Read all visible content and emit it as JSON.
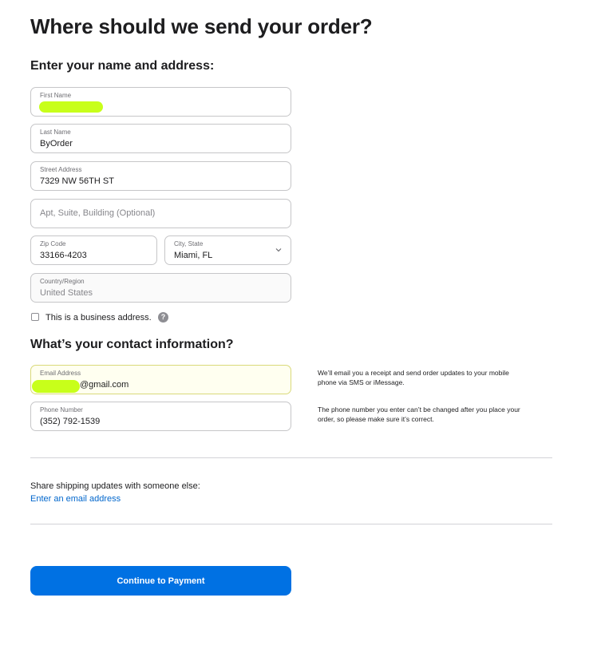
{
  "page": {
    "title": "Where should we send your order?"
  },
  "address_section": {
    "heading": "Enter your name and address:",
    "first_name": {
      "label": "First Name",
      "value": ""
    },
    "last_name": {
      "label": "Last Name",
      "value": "ByOrder"
    },
    "street": {
      "label": "Street Address",
      "value": "7329 NW 56TH ST"
    },
    "apt": {
      "placeholder": "Apt, Suite, Building (Optional)"
    },
    "zip": {
      "label": "Zip Code",
      "value": "33166-4203"
    },
    "city_state": {
      "label": "City, State",
      "value": "Miami, FL"
    },
    "country": {
      "label": "Country/Region",
      "value": "United States"
    },
    "business_checkbox": {
      "label": "This is a business address.",
      "checked": false,
      "help": "?"
    }
  },
  "contact_section": {
    "heading": "What’s your contact information?",
    "email": {
      "label": "Email Address",
      "value": "@gmail.com"
    },
    "email_note": "We’ll email you a receipt and send order updates to your mobile phone via SMS or iMessage.",
    "phone": {
      "label": "Phone Number",
      "value": "(352) 792-1539"
    },
    "phone_note": "The phone number you enter can’t be changed after you place your order, so please make sure it’s correct."
  },
  "share": {
    "text": "Share shipping updates with someone else:",
    "link": "Enter an email address"
  },
  "actions": {
    "continue_label": "Continue to Payment"
  },
  "colors": {
    "accent": "#0071e3",
    "link": "#0066cc",
    "redaction": "#c8ff1a"
  }
}
